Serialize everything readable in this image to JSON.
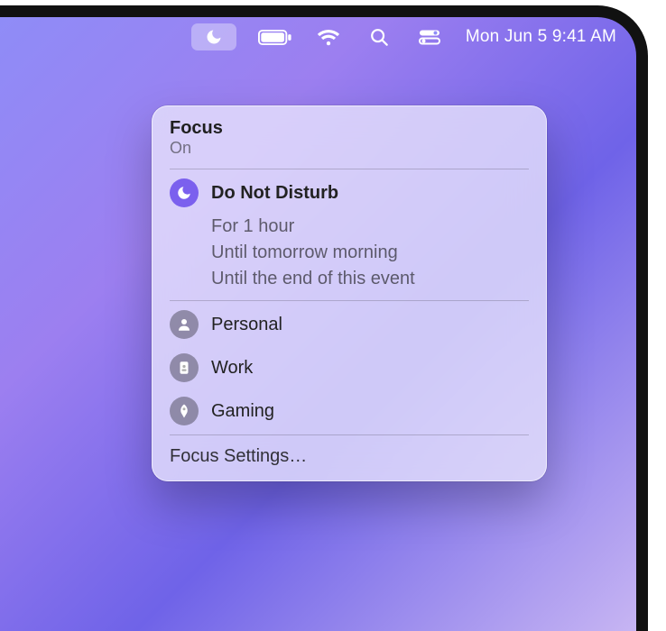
{
  "menubar": {
    "datetime": "Mon Jun 5  9:41 AM",
    "icons": {
      "focus": "moon-icon",
      "battery": "battery-icon",
      "wifi": "wifi-icon",
      "search": "search-icon",
      "control_center": "control-center-icon"
    }
  },
  "focus_panel": {
    "title": "Focus",
    "status": "On",
    "active_mode": {
      "icon": "moon-icon",
      "label": "Do Not Disturb"
    },
    "duration_options": [
      "For 1 hour",
      "Until tomorrow morning",
      "Until the end of this event"
    ],
    "other_modes": [
      {
        "icon": "person-icon",
        "label": "Personal"
      },
      {
        "icon": "badge-icon",
        "label": "Work"
      },
      {
        "icon": "rocket-icon",
        "label": "Gaming"
      }
    ],
    "settings_label": "Focus Settings…"
  },
  "colors": {
    "accent": "#7b60ee"
  }
}
